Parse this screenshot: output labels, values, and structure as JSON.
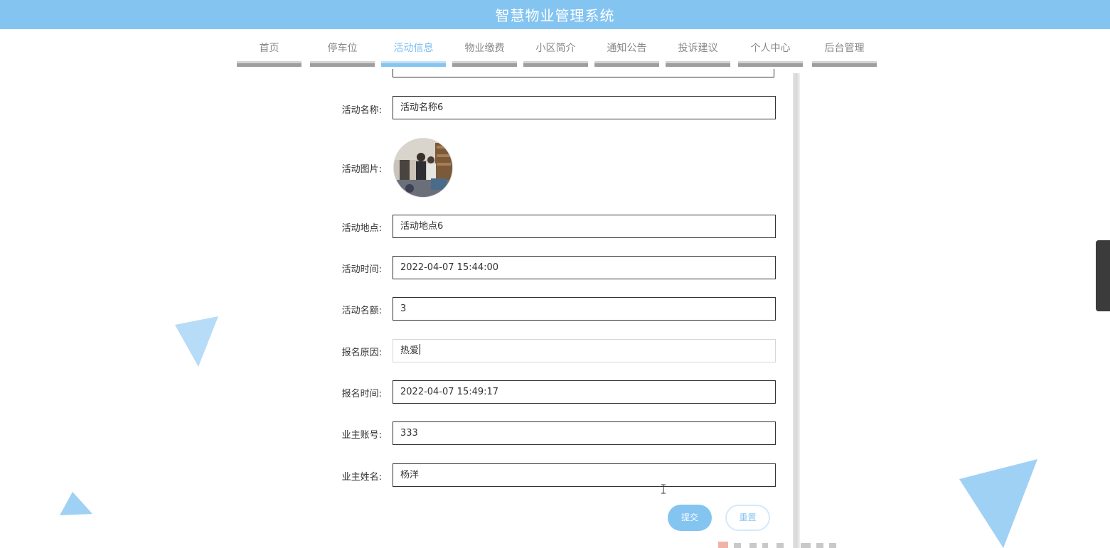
{
  "header": {
    "title": "智慧物业管理系统"
  },
  "nav": {
    "items": [
      {
        "label": "首页",
        "active": false
      },
      {
        "label": "停车位",
        "active": false
      },
      {
        "label": "活动信息",
        "active": true
      },
      {
        "label": "物业缴费",
        "active": false
      },
      {
        "label": "小区简介",
        "active": false
      },
      {
        "label": "通知公告",
        "active": false
      },
      {
        "label": "投诉建议",
        "active": false
      },
      {
        "label": "个人中心",
        "active": false
      },
      {
        "label": "后台管理",
        "active": false
      }
    ]
  },
  "form": {
    "activity_name": {
      "label": "活动名称:",
      "value": "活动名称6"
    },
    "activity_image": {
      "label": "活动图片:"
    },
    "activity_location": {
      "label": "活动地点:",
      "value": "活动地点6"
    },
    "activity_time": {
      "label": "活动时间:",
      "value": "2022-04-07 15:44:00"
    },
    "activity_quota": {
      "label": "活动名额:",
      "value": "3"
    },
    "signup_reason": {
      "label": "报名原因:",
      "value": "热爱"
    },
    "signup_time": {
      "label": "报名时间:",
      "value": "2022-04-07 15:49:17"
    },
    "owner_account": {
      "label": "业主账号:",
      "value": "333"
    },
    "owner_name": {
      "label": "业主姓名:",
      "value": "杨洋"
    }
  },
  "buttons": {
    "submit": "提交",
    "reset": "重置"
  },
  "colors": {
    "primary": "#84c4f1",
    "nav_inactive": "#888888",
    "nav_bar": "#9e9e9e",
    "triangle": "#9fd1f5"
  }
}
